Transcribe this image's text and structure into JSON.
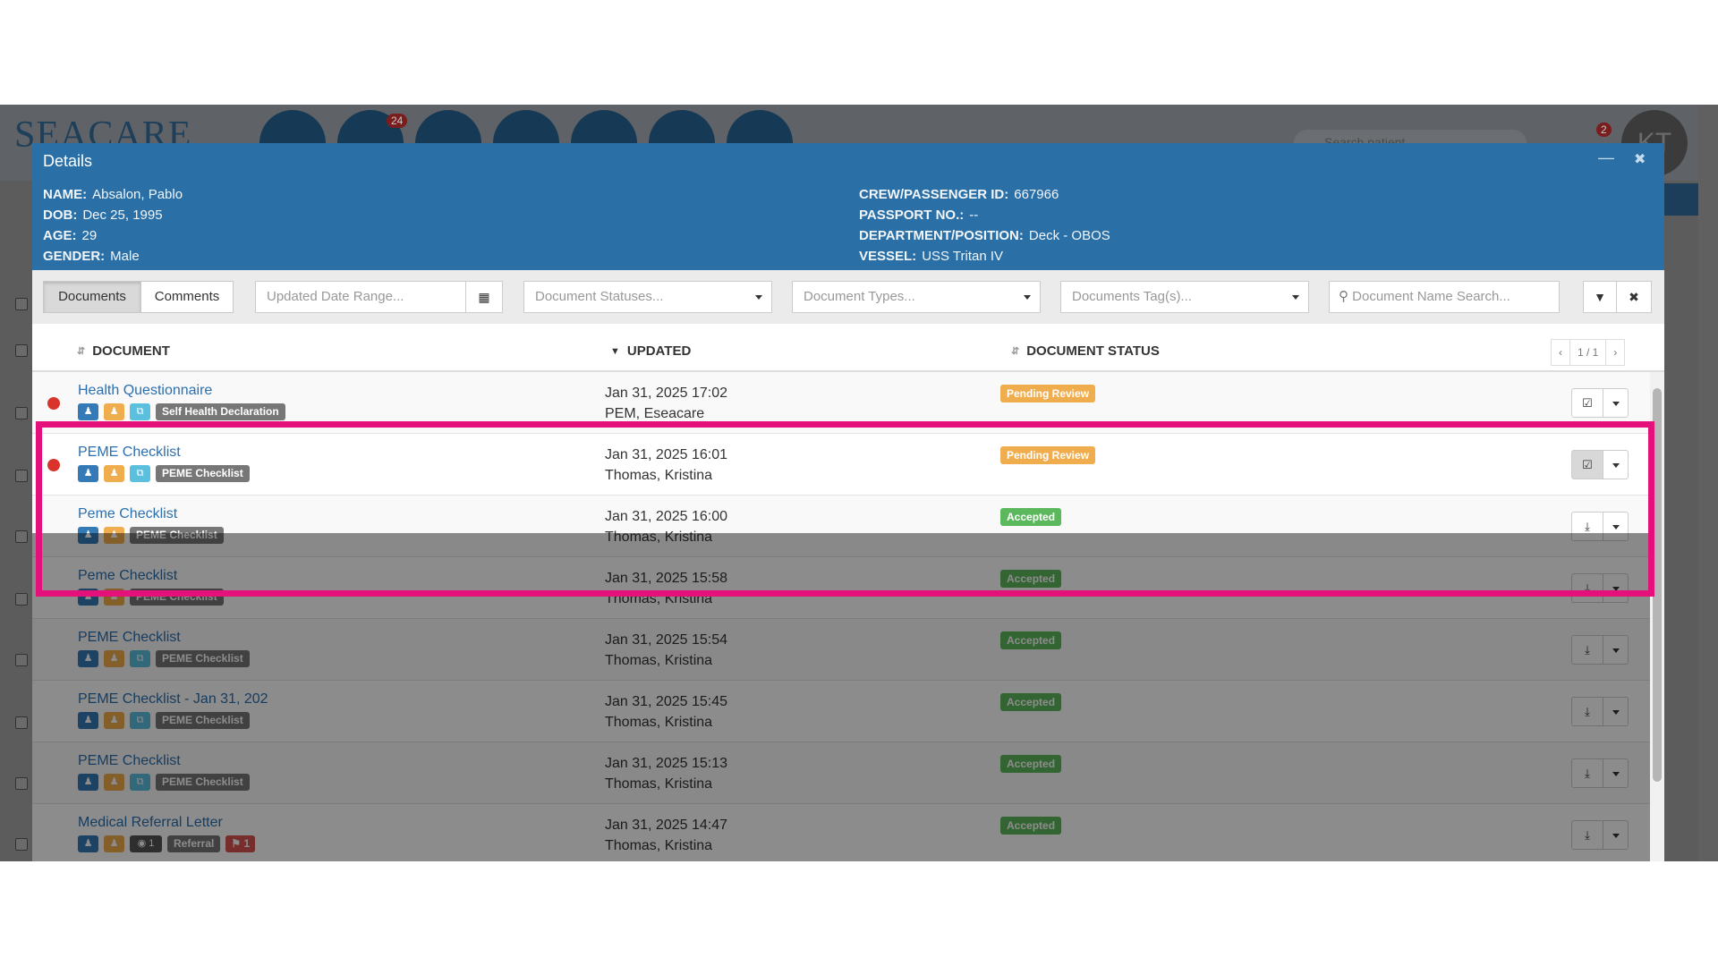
{
  "background_app": {
    "logo": "SEACARE",
    "notification_count": "24",
    "alert_count": "2",
    "search_placeholder": "Search patient",
    "avatar_initials": "KT"
  },
  "modal": {
    "title": "Details",
    "patient_left": [
      {
        "label": "NAME:",
        "value": "Absalon, Pablo"
      },
      {
        "label": "DOB:",
        "value": "Dec 25, 1995"
      },
      {
        "label": "AGE:",
        "value": "29"
      },
      {
        "label": "GENDER:",
        "value": "Male"
      }
    ],
    "patient_right": [
      {
        "label": "CREW/PASSENGER ID:",
        "value": "667966"
      },
      {
        "label": "PASSPORT NO.:",
        "value": "--"
      },
      {
        "label": "DEPARTMENT/POSITION:",
        "value": "Deck - OBOS"
      },
      {
        "label": "VESSEL:",
        "value": "USS Tritan IV"
      }
    ]
  },
  "toolbar": {
    "tabs": [
      "Documents",
      "Comments"
    ],
    "date_range_placeholder": "Updated Date Range...",
    "statuses_placeholder": "Document Statuses...",
    "types_placeholder": "Document Types...",
    "tags_placeholder": "Documents Tag(s)...",
    "name_search_placeholder": "Document Name Search..."
  },
  "table": {
    "columns": [
      "DOCUMENT",
      "UPDATED",
      "DOCUMENT STATUS"
    ],
    "pagination": "1 / 1",
    "rows": [
      {
        "name": "Health Questionnaire",
        "updated": "Jan 31, 2025 17:02",
        "by": "PEM, Eseacare",
        "status": "Pending Review",
        "label": "Self Health Declaration",
        "unread": true
      },
      {
        "name": "PEME Checklist",
        "updated": "Jan 31, 2025 16:01",
        "by": "Thomas, Kristina",
        "status": "Pending Review",
        "label": "PEME Checklist",
        "unread": true
      },
      {
        "name": "Peme Checklist",
        "updated": "Jan 31, 2025 16:00",
        "by": "Thomas, Kristina",
        "status": "Accepted",
        "label": "PEME Checklist"
      },
      {
        "name": "Peme Checklist",
        "updated": "Jan 31, 2025 15:58",
        "by": "Thomas, Kristina",
        "status": "Accepted",
        "label": "PEME Checklist"
      },
      {
        "name": "PEME Checklist",
        "updated": "Jan 31, 2025 15:54",
        "by": "Thomas, Kristina",
        "status": "Accepted",
        "label": "PEME Checklist"
      },
      {
        "name": "PEME Checklist - Jan 31, 202",
        "updated": "Jan 31, 2025 15:45",
        "by": "Thomas, Kristina",
        "status": "Accepted",
        "label": "PEME Checklist"
      },
      {
        "name": "PEME Checklist",
        "updated": "Jan 31, 2025 15:13",
        "by": "Thomas, Kristina",
        "status": "Accepted",
        "label": "PEME Checklist"
      },
      {
        "name": "Medical Referral Letter",
        "updated": "Jan 31, 2025 14:47",
        "by": "Thomas, Kristina",
        "status": "Accepted",
        "label": "Referral",
        "comment_count": "1",
        "tag_count": "1"
      }
    ]
  },
  "colors": {
    "header_blue": "#2a6fa6",
    "highlight": "#e4117a",
    "pending": "#f0ad4e",
    "accepted": "#5cb85c"
  }
}
